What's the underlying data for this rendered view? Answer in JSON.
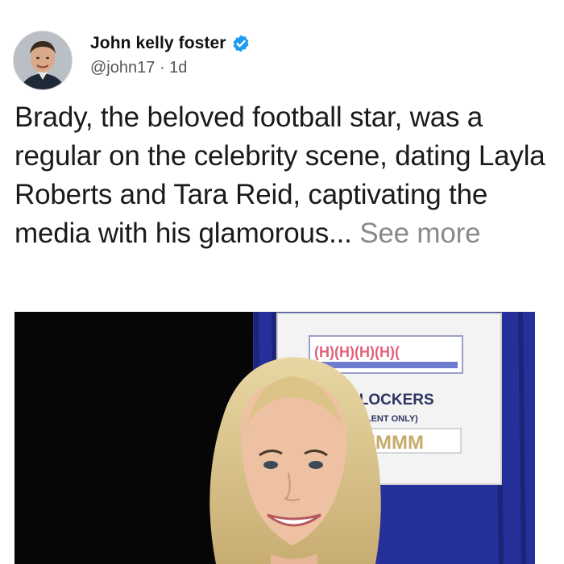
{
  "tweet": {
    "author": {
      "display_name": "John kelly foster",
      "handle": "@john17",
      "separator": "·",
      "time": "1d",
      "verified": true
    },
    "text": "Brady, the beloved football star, was a regular on the celebrity scene, dating Layla Roberts and Tara Reid, captivating the media with his glamorous...",
    "see_more": "See more",
    "media": {
      "sign_title": "I'S LOCKERS",
      "sign_subtitle": "TALENT ONLY)"
    }
  },
  "colors": {
    "verified_badge": "#1d9bf0",
    "see_more": "#8a8a8a",
    "backdrop_blue": "#25309a"
  },
  "icons": {
    "verified": "verified-badge-icon"
  }
}
